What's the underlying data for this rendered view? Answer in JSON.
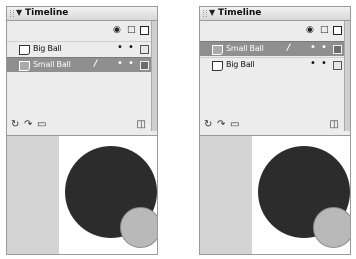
{
  "panels": [
    {
      "title": "Timeline",
      "layers": [
        {
          "name": "Big Ball",
          "selected": false
        },
        {
          "name": "Small Ball",
          "selected": true
        }
      ]
    },
    {
      "title": "Timeline",
      "layers": [
        {
          "name": "Small Ball",
          "selected": true
        },
        {
          "name": "Big Ball",
          "selected": false
        }
      ]
    }
  ],
  "header_icons": [
    "eye-icon",
    "lock-icon",
    "outline-icon"
  ],
  "footer_icons": [
    "insert-layer-icon",
    "add-motion-guide-icon",
    "insert-folder-icon",
    "delete-layer-icon"
  ],
  "glyphs": {
    "arrow": "▼",
    "pencil": "/",
    "dot": "•"
  },
  "colors": {
    "selected_row": "#8f8f8f",
    "big_ball": "#2c2c2c",
    "small_ball": "#b9b9b9",
    "offstage": "#d4d4d4"
  }
}
